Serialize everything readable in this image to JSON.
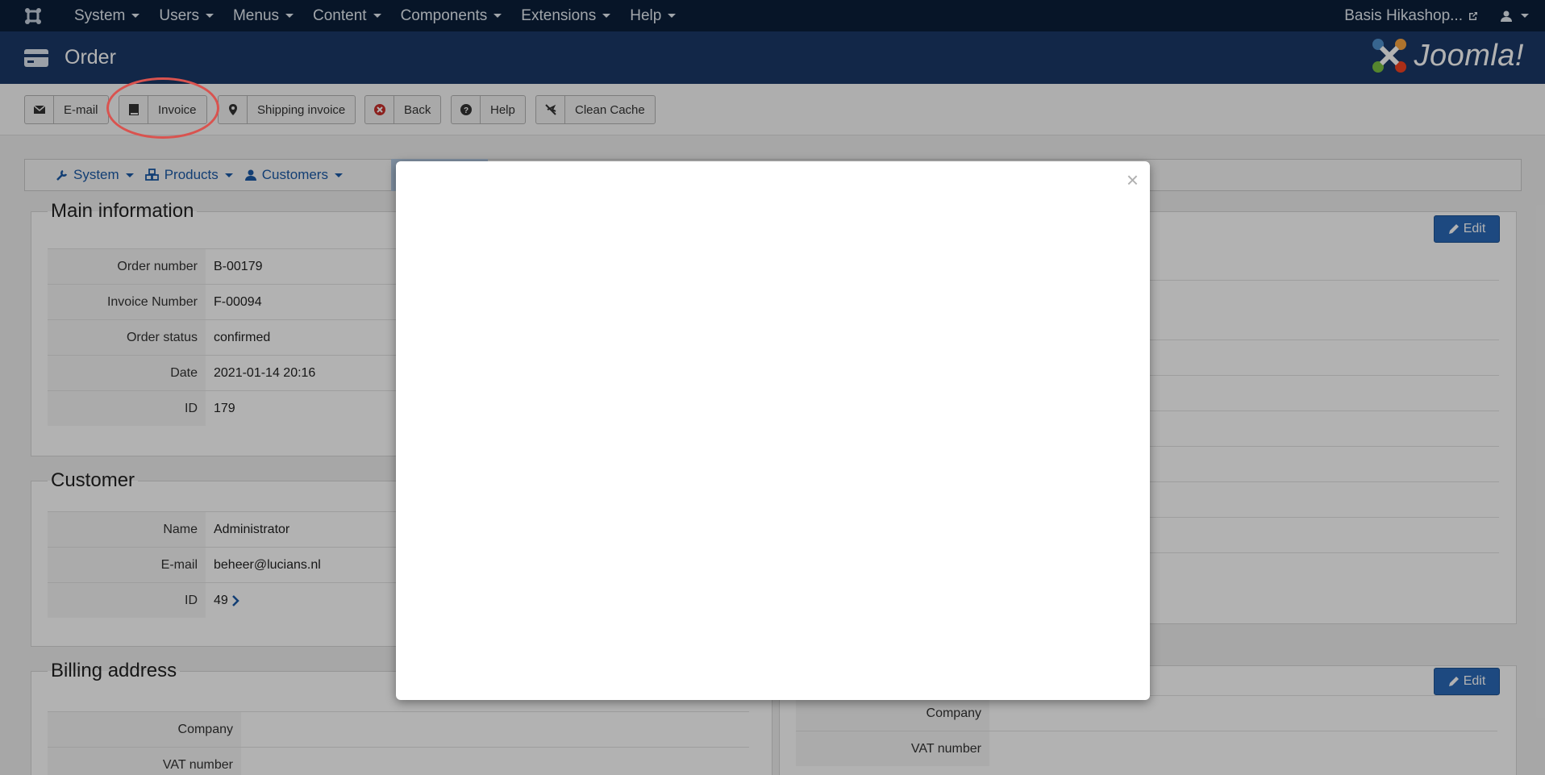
{
  "topnav": {
    "menu": [
      "System",
      "Users",
      "Menus",
      "Content",
      "Components",
      "Extensions",
      "Help"
    ],
    "site_link": "Basis Hikashop...",
    "user_icon": "user-icon"
  },
  "header": {
    "title": "Order",
    "logo_text": "Joomla!"
  },
  "toolbar": {
    "email": "E-mail",
    "invoice": "Invoice",
    "shipping_invoice": "Shipping invoice",
    "back": "Back",
    "help": "Help",
    "clean_cache": "Clean Cache"
  },
  "subnav": {
    "system": "System",
    "products": "Products",
    "customers": "Customers"
  },
  "main_information": {
    "legend": "Main information",
    "rows": [
      {
        "label": "Order number",
        "value": "B-00179"
      },
      {
        "label": "Invoice Number",
        "value": "F-00094"
      },
      {
        "label": "Order status",
        "value": "confirmed"
      },
      {
        "label": "Date",
        "value": "2021-01-14 20:16"
      },
      {
        "label": "ID",
        "value": "179"
      }
    ]
  },
  "customer": {
    "legend": "Customer",
    "rows": [
      {
        "label": "Name",
        "value": "Administrator"
      },
      {
        "label": "E-mail",
        "value": "beheer@lucians.nl"
      },
      {
        "label": "ID",
        "value": "49"
      }
    ]
  },
  "billing_address": {
    "legend": "Billing address",
    "rows": [
      {
        "label": "Company",
        "value": ""
      },
      {
        "label": "VAT number",
        "value": ""
      }
    ]
  },
  "shipping_address": {
    "rows": [
      {
        "label": "Company",
        "value": ""
      },
      {
        "label": "VAT number",
        "value": ""
      }
    ]
  },
  "buttons": {
    "edit": "Edit"
  },
  "modal": {
    "close": "×"
  },
  "colors": {
    "topnav": "#0b1f3a",
    "header": "#1a3867",
    "edit_button": "#2a69b8",
    "highlight_ring": "#d9534f"
  }
}
